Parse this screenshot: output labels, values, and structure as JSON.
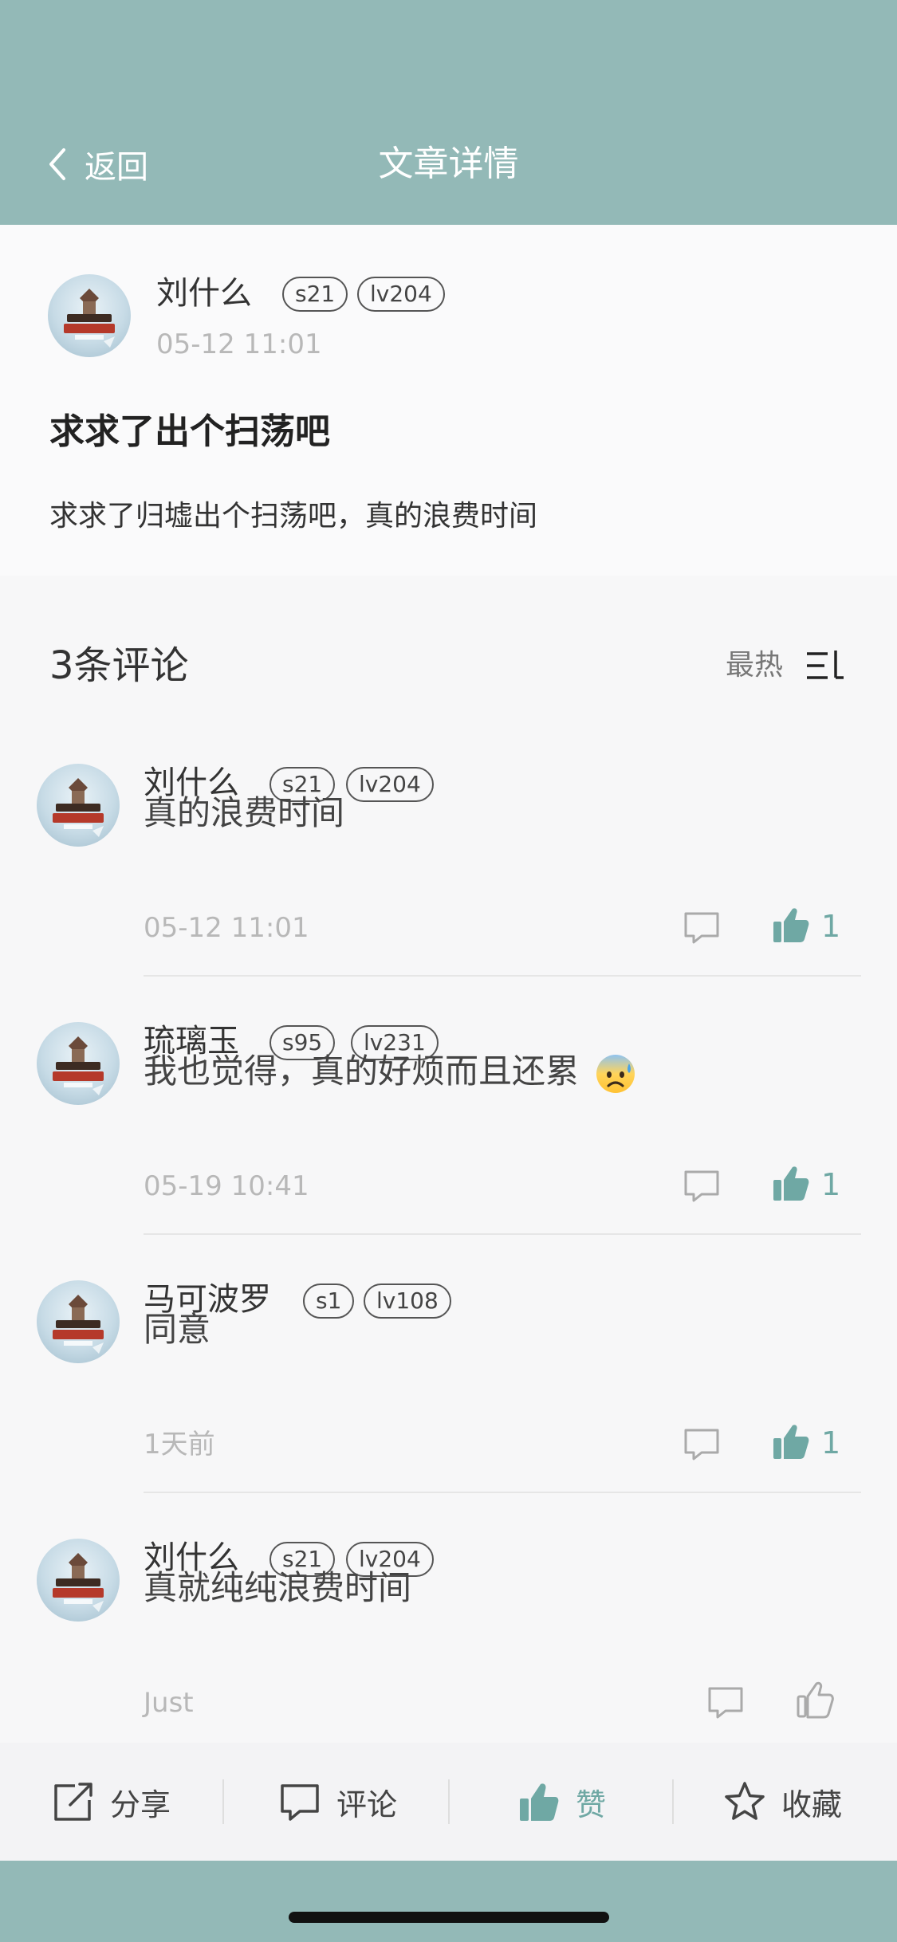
{
  "nav": {
    "back_label": "返回",
    "title": "文章详情"
  },
  "article": {
    "author": "刘什么",
    "badges": [
      "s21",
      "lv204"
    ],
    "time": "05-12 11:01",
    "title": "求求了出个扫荡吧",
    "body": "求求了归墟出个扫荡吧，真的浪费时间"
  },
  "comments_header": {
    "count_label": "3条评论",
    "sort_label": "最热"
  },
  "comments": [
    {
      "user": "刘什么",
      "badges": [
        "s21",
        "lv204"
      ],
      "text": "真的浪费时间",
      "time": "05-12 11:01",
      "likes": "1",
      "liked": true
    },
    {
      "user": "琉璃玉",
      "badges": [
        "s95",
        "lv231"
      ],
      "text": "我也觉得，真的好烦而且还累",
      "emoji": "anxious-sweat-emoji",
      "time": "05-19 10:41",
      "likes": "1",
      "liked": true
    },
    {
      "user": "马可波罗",
      "badges": [
        "s1",
        "lv108"
      ],
      "text": "同意",
      "time": "1天前",
      "likes": "1",
      "liked": true
    },
    {
      "user": "刘什么",
      "badges": [
        "s21",
        "lv204"
      ],
      "text": "真就纯纯浪费时间",
      "time": "Just",
      "likes": "",
      "liked": false
    }
  ],
  "bottom_bar": {
    "share": "分享",
    "comment": "评论",
    "like": "赞",
    "favorite": "收藏"
  },
  "colors": {
    "accent": "#93b9b7",
    "like": "#6fa8a4"
  }
}
